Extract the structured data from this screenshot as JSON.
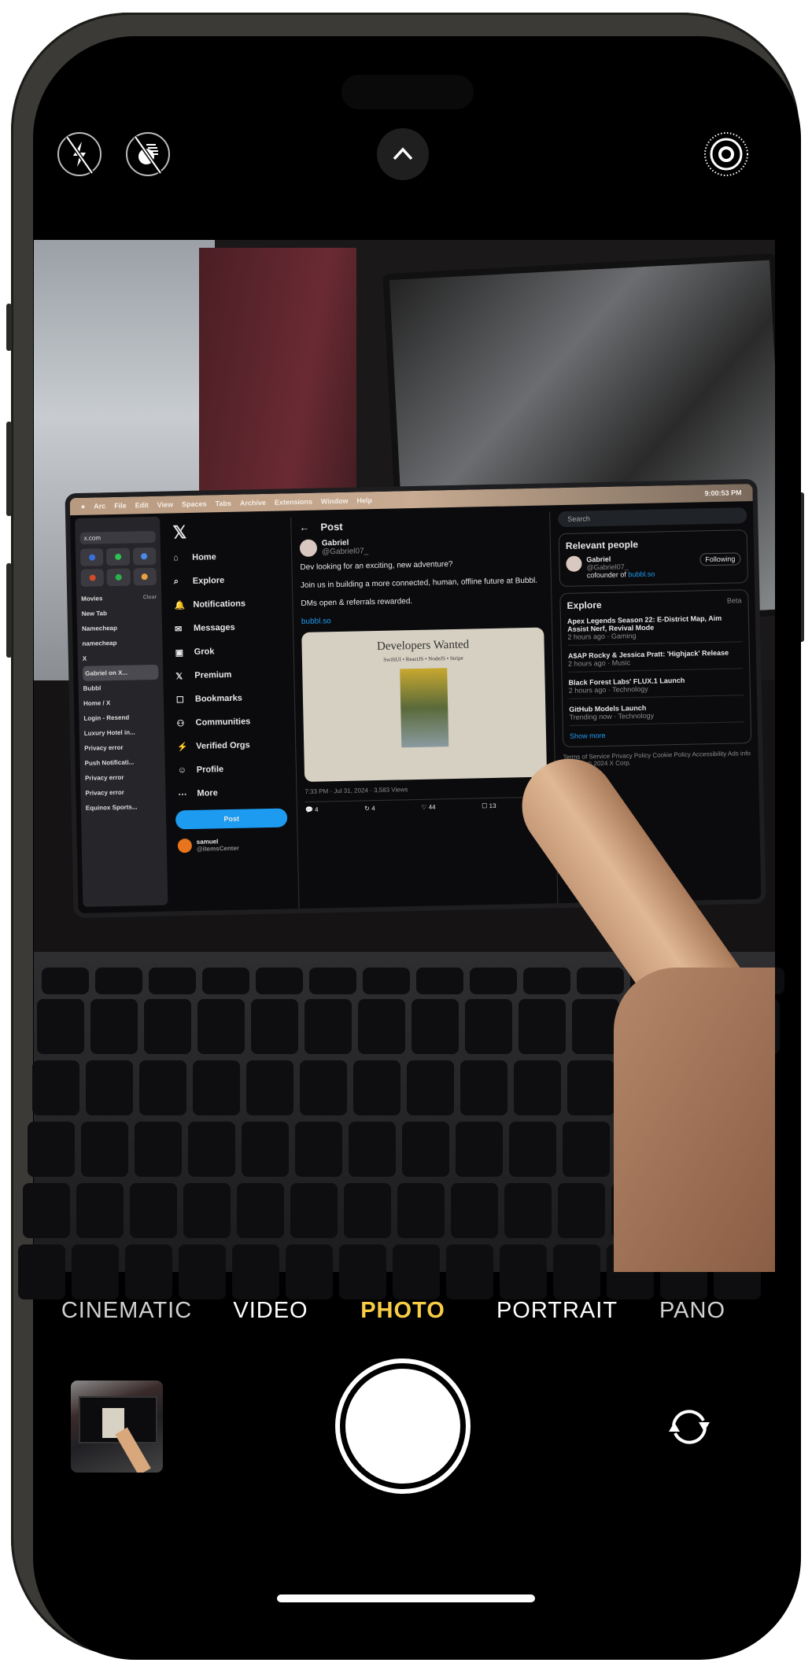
{
  "top_controls": {
    "flash_icon": "flash-off-icon",
    "live_icon": "live-photo-off-icon",
    "expand_icon": "chevron-up-icon",
    "live_photo_icon": "live-photo-icon"
  },
  "viewfinder": {
    "laptop_screen": {
      "menubar": [
        "Arc",
        "File",
        "Edit",
        "View",
        "Spaces",
        "Tabs",
        "Archive",
        "Extensions",
        "Window",
        "Help"
      ],
      "clock": "9:00:53 PM",
      "arc_sidebar": {
        "url": "x.com",
        "folder": "Movies",
        "clear": "Clear",
        "tabs": [
          "New Tab",
          "Namecheap",
          "namecheap",
          "X",
          "Gabriel on X...",
          "Bubbl",
          "Home / X",
          "Login - Resend",
          "Luxury Hotel in...",
          "Privacy error",
          "Push Notificati...",
          "Privacy error",
          "Privacy error",
          "Equinox Sports..."
        ]
      },
      "x_nav": {
        "items": [
          "Home",
          "Explore",
          "Notifications",
          "Messages",
          "Grok",
          "Premium",
          "Bookmarks",
          "Communities",
          "Verified Orgs",
          "Profile",
          "More"
        ],
        "post_button": "Post",
        "account_name": "samuel",
        "account_handle": "@itemsCenter"
      },
      "post": {
        "header": "Post",
        "author": "Gabriel",
        "handle": "@Gabriel07_",
        "lines": [
          "Dev looking for an exciting, new adventure?",
          "Join us in building a more connected, human, offline future at Bubbl.",
          "DMs open & referrals rewarded."
        ],
        "link": "bubbl.so",
        "image_title": "Developers Wanted",
        "image_subtitle": "SwiftUI • ReactJS • NodeJS • Stripe",
        "meta": "7:33 PM · Jul 31, 2024 · 3,583 Views",
        "replies": "4",
        "reposts": "4",
        "likes": "44",
        "bookmarks": "13"
      },
      "right_column": {
        "search_placeholder": "Search",
        "relevant_title": "Relevant people",
        "person_name": "Gabriel",
        "person_handle": "@Gabriel07_",
        "person_bio": "cofounder of",
        "person_link": "bubbl.so",
        "following": "Following",
        "explore_title": "Explore",
        "beta": "Beta",
        "trends": [
          {
            "title": "Apex Legends Season 22: E-District Map, Aim Assist Nerf, Revival Mode",
            "meta": "2 hours ago · Gaming"
          },
          {
            "title": "A$AP Rocky & Jessica Pratt: 'Highjack' Release",
            "meta": "2 hours ago · Music"
          },
          {
            "title": "Black Forest Labs' FLUX.1 Launch",
            "meta": "2 hours ago · Technology"
          },
          {
            "title": "GitHub Models Launch",
            "meta": "Trending now · Technology"
          }
        ],
        "show_more": "Show more",
        "footer": "Terms of Service  Privacy Policy  Cookie Policy  Accessibility  Ads info  More ···  © 2024 X Corp."
      }
    }
  },
  "modes": {
    "items": [
      "CINEMATIC",
      "VIDEO",
      "PHOTO",
      "PORTRAIT",
      "PANO"
    ],
    "selected": "PHOTO",
    "selected_color": "#f7cd46"
  },
  "bottom_controls": {
    "thumbnail_icon": "last-photo-thumbnail",
    "shutter_icon": "shutter-button",
    "flip_icon": "flip-camera-icon"
  }
}
